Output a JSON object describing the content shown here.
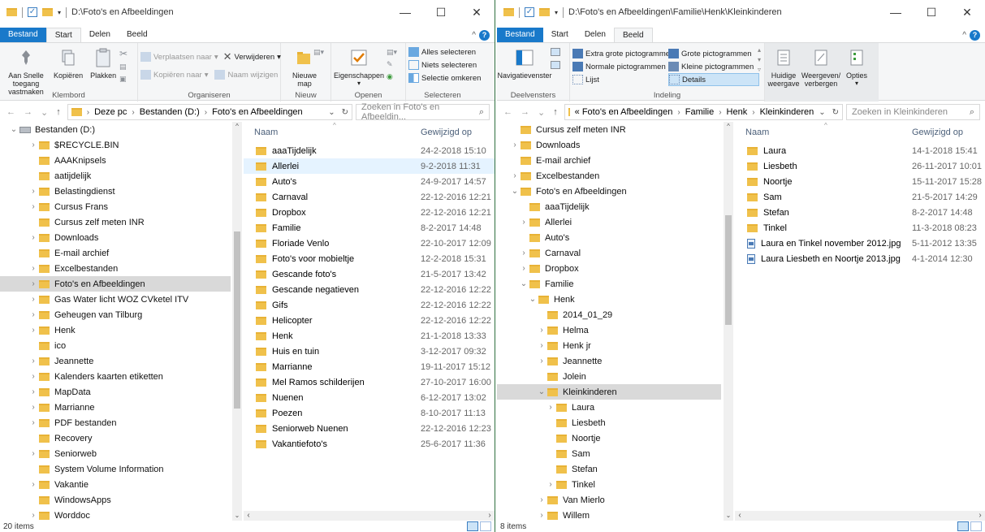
{
  "colors": {
    "accent": "#1979ca",
    "folder": "#f0c14b",
    "selected_tree": "#d9d9d9",
    "selected_row": "#e5f3ff",
    "header_text": "#4c607a"
  },
  "left": {
    "title": "D:\\Foto's en Afbeeldingen",
    "tabs": {
      "file": "Bestand",
      "start": "Start",
      "share": "Delen",
      "view": "Beeld"
    },
    "ribbon": {
      "pin": "Aan Snelle toegang vastmaken",
      "copy": "Kopiëren",
      "paste": "Plakken",
      "clipboard_label": "Klembord",
      "move_to": "Verplaatsen naar",
      "copy_to": "Kopiëren naar",
      "delete": "Verwijderen",
      "rename": "Naam wijzigen",
      "organize_label": "Organiseren",
      "new_folder": "Nieuwe map",
      "new_label": "Nieuw",
      "properties": "Eigenschappen",
      "open_label": "Openen",
      "select_all": "Alles selecteren",
      "select_none": "Niets selecteren",
      "invert_selection": "Selectie omkeren",
      "select_label": "Selecteren"
    },
    "address": {
      "crumbs": [
        "Deze pc",
        "Bestanden (D:)",
        "Foto's en Afbeeldingen"
      ],
      "search_placeholder": "Zoeken in Foto's en Afbeeldin..."
    },
    "tree": [
      {
        "label": "Bestanden (D:)",
        "expanded": true,
        "drive": true
      },
      {
        "label": "$RECYCLE.BIN",
        "hasChildren": true
      },
      {
        "label": "AAAKnipsels"
      },
      {
        "label": "aatijdelijk"
      },
      {
        "label": "Belastingdienst",
        "hasChildren": true
      },
      {
        "label": "Cursus Frans",
        "hasChildren": true
      },
      {
        "label": "Cursus zelf meten INR"
      },
      {
        "label": "Downloads",
        "hasChildren": true
      },
      {
        "label": "E-mail archief"
      },
      {
        "label": "Excelbestanden",
        "hasChildren": true
      },
      {
        "label": "Foto's en Afbeeldingen",
        "hasChildren": true,
        "selected": true
      },
      {
        "label": "Gas Water licht WOZ CVketel ITV",
        "hasChildren": true
      },
      {
        "label": "Geheugen van Tilburg",
        "hasChildren": true
      },
      {
        "label": "Henk",
        "hasChildren": true
      },
      {
        "label": "ico"
      },
      {
        "label": "Jeannette",
        "hasChildren": true
      },
      {
        "label": "Kalenders kaarten etiketten",
        "hasChildren": true
      },
      {
        "label": "MapData",
        "hasChildren": true
      },
      {
        "label": "Marrianne",
        "hasChildren": true
      },
      {
        "label": "PDF bestanden",
        "hasChildren": true
      },
      {
        "label": "Recovery"
      },
      {
        "label": "Seniorweb",
        "hasChildren": true
      },
      {
        "label": "System Volume Information"
      },
      {
        "label": "Vakantie",
        "hasChildren": true
      },
      {
        "label": "WindowsApps"
      },
      {
        "label": "Worddoc",
        "hasChildren": true
      }
    ],
    "columns": {
      "name": "Naam",
      "modified": "Gewijzigd op"
    },
    "files": [
      {
        "name": "aaaTijdelijk",
        "date": "24-2-2018 15:10"
      },
      {
        "name": "Allerlei",
        "date": "9-2-2018 11:31",
        "selected": true
      },
      {
        "name": "Auto's",
        "date": "24-9-2017 14:57"
      },
      {
        "name": "Carnaval",
        "date": "22-12-2016 12:21"
      },
      {
        "name": "Dropbox",
        "date": "22-12-2016 12:21"
      },
      {
        "name": "Familie",
        "date": "8-2-2017 14:48"
      },
      {
        "name": "Floriade Venlo",
        "date": "22-10-2017 12:09"
      },
      {
        "name": "Foto's voor mobieltje",
        "date": "12-2-2018 15:31"
      },
      {
        "name": "Gescande foto's",
        "date": "21-5-2017 13:42"
      },
      {
        "name": "Gescande negatieven",
        "date": "22-12-2016 12:22"
      },
      {
        "name": "Gifs",
        "date": "22-12-2016 12:22"
      },
      {
        "name": "Helicopter",
        "date": "22-12-2016 12:22"
      },
      {
        "name": "Henk",
        "date": "21-1-2018 13:33"
      },
      {
        "name": "Huis en tuin",
        "date": "3-12-2017 09:32"
      },
      {
        "name": "Marrianne",
        "date": "19-11-2017 15:12"
      },
      {
        "name": "Mel Ramos schilderijen",
        "date": "27-10-2017 16:00"
      },
      {
        "name": "Nuenen",
        "date": "6-12-2017 13:02"
      },
      {
        "name": "Poezen",
        "date": "8-10-2017 11:13"
      },
      {
        "name": "Seniorweb Nuenen",
        "date": "22-12-2016 12:23"
      },
      {
        "name": "Vakantiefoto's",
        "date": "25-6-2017 11:36"
      }
    ],
    "status": "20 items"
  },
  "right": {
    "title": "D:\\Foto's en Afbeeldingen\\Familie\\Henk\\Kleinkinderen",
    "tabs": {
      "file": "Bestand",
      "start": "Start",
      "share": "Delen",
      "view": "Beeld"
    },
    "ribbon": {
      "nav_pane": "Navigatievenster",
      "panes_label": "Deelvensters",
      "xl_icons": "Extra grote pictogrammen",
      "large_icons": "Grote pictogrammen",
      "normal_icons": "Normale pictogrammen",
      "small_icons": "Kleine pictogrammen",
      "list": "Lijst",
      "details": "Details",
      "layout_label": "Indeling",
      "current_view": "Huidige weergave",
      "show_hide": "Weergeven/ verbergen",
      "options": "Opties"
    },
    "address": {
      "crumbs": [
        "« Foto's en Afbeeldingen",
        "Familie",
        "Henk",
        "Kleinkinderen"
      ],
      "search_placeholder": "Zoeken in Kleinkinderen"
    },
    "tree": [
      {
        "label": "Cursus zelf meten INR",
        "level": 1
      },
      {
        "label": "Downloads",
        "level": 1,
        "hasChildren": true
      },
      {
        "label": "E-mail archief",
        "level": 1
      },
      {
        "label": "Excelbestanden",
        "level": 1,
        "hasChildren": true
      },
      {
        "label": "Foto's en Afbeeldingen",
        "level": 1,
        "expanded": true
      },
      {
        "label": "aaaTijdelijk",
        "level": 2
      },
      {
        "label": "Allerlei",
        "level": 2,
        "hasChildren": true
      },
      {
        "label": "Auto's",
        "level": 2
      },
      {
        "label": "Carnaval",
        "level": 2,
        "hasChildren": true
      },
      {
        "label": "Dropbox",
        "level": 2,
        "hasChildren": true
      },
      {
        "label": "Familie",
        "level": 2,
        "expanded": true
      },
      {
        "label": "Henk",
        "level": 3,
        "expanded": true
      },
      {
        "label": "2014_01_29",
        "level": 4
      },
      {
        "label": "Helma",
        "level": 4,
        "hasChildren": true
      },
      {
        "label": "Henk jr",
        "level": 4,
        "hasChildren": true
      },
      {
        "label": "Jeannette",
        "level": 4,
        "hasChildren": true
      },
      {
        "label": "Jolein",
        "level": 4
      },
      {
        "label": "Kleinkinderen",
        "level": 4,
        "expanded": true,
        "selected": true
      },
      {
        "label": "Laura",
        "level": 5,
        "hasChildren": true
      },
      {
        "label": "Liesbeth",
        "level": 5
      },
      {
        "label": "Noortje",
        "level": 5
      },
      {
        "label": "Sam",
        "level": 5
      },
      {
        "label": "Stefan",
        "level": 5
      },
      {
        "label": "Tinkel",
        "level": 5,
        "hasChildren": true
      },
      {
        "label": "Van Mierlo",
        "level": 4,
        "hasChildren": true
      },
      {
        "label": "Willem",
        "level": 4,
        "hasChildren": true
      }
    ],
    "columns": {
      "name": "Naam",
      "modified": "Gewijzigd op"
    },
    "files": [
      {
        "name": "Laura",
        "date": "14-1-2018 15:41",
        "type": "folder"
      },
      {
        "name": "Liesbeth",
        "date": "26-11-2017 10:01",
        "type": "folder"
      },
      {
        "name": "Noortje",
        "date": "15-11-2017 15:28",
        "type": "folder"
      },
      {
        "name": "Sam",
        "date": "21-5-2017 14:29",
        "type": "folder"
      },
      {
        "name": "Stefan",
        "date": "8-2-2017 14:48",
        "type": "folder"
      },
      {
        "name": "Tinkel",
        "date": "11-3-2018 08:23",
        "type": "folder"
      },
      {
        "name": "Laura en Tinkel november 2012.jpg",
        "date": "5-11-2012 13:35",
        "type": "image"
      },
      {
        "name": "Laura Liesbeth en Noortje 2013.jpg",
        "date": "4-1-2014 12:30",
        "type": "image"
      }
    ],
    "status": "8 items"
  }
}
